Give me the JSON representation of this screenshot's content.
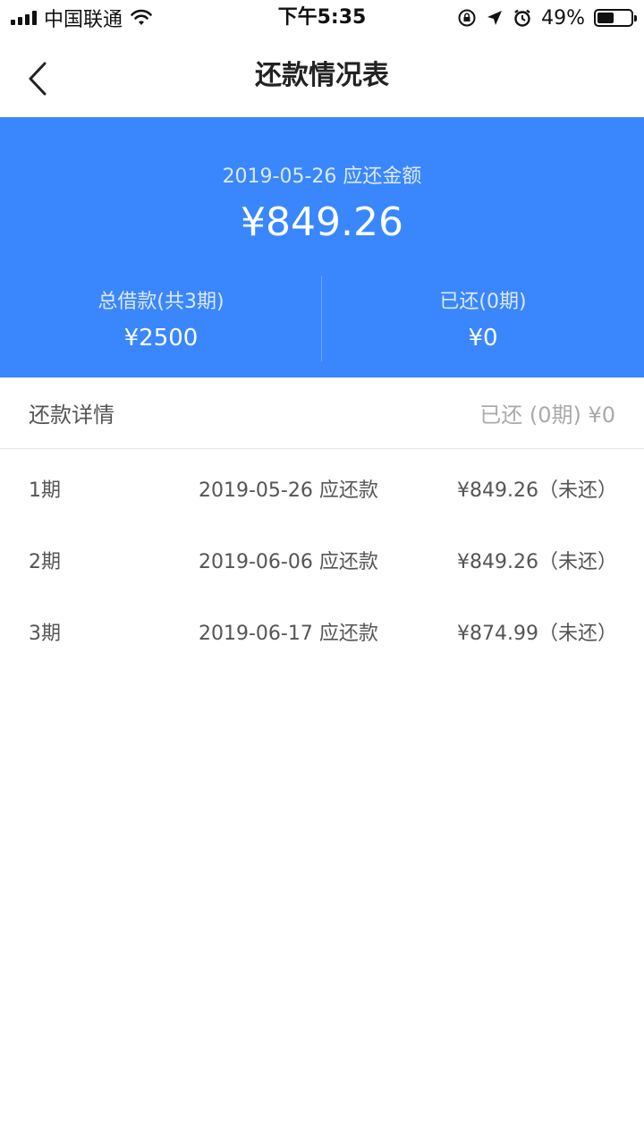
{
  "status_bar": {
    "carrier": "中国联通",
    "time": "下午5:35",
    "battery_percent": "49%",
    "battery_level": 0.49
  },
  "nav": {
    "title": "还款情况表"
  },
  "summary": {
    "due_label": "2019-05-26 应还金额",
    "due_amount": "¥849.26",
    "total_label": "总借款(共3期)",
    "total_value": "¥2500",
    "paid_label": "已还(0期)",
    "paid_value": "¥0",
    "bg_color": "#3a87fd"
  },
  "section": {
    "title": "还款详情",
    "paid_summary": "已还 (0期) ¥0"
  },
  "installments": [
    {
      "period": "1期",
      "date": "2019-05-26 应还款",
      "amount": "¥849.26（未还）"
    },
    {
      "period": "2期",
      "date": "2019-06-06 应还款",
      "amount": "¥849.26（未还）"
    },
    {
      "period": "3期",
      "date": "2019-06-17 应还款",
      "amount": "¥874.99（未还）"
    }
  ],
  "icons": {
    "signal": "signal-icon",
    "wifi": "wifi-icon",
    "rotation_lock": "rotation-lock-icon",
    "location": "location-icon",
    "alarm": "alarm-icon",
    "battery": "battery-icon",
    "back": "back-chevron-icon"
  }
}
